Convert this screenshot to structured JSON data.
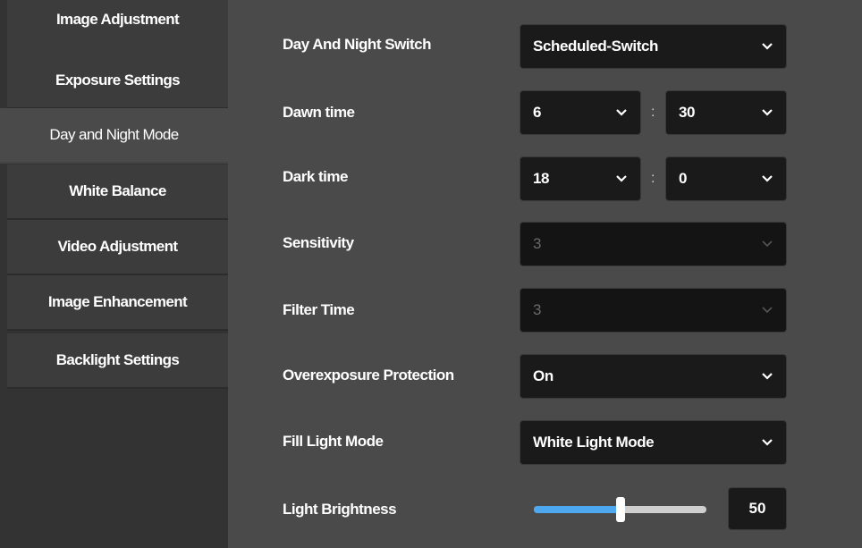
{
  "sidebar": {
    "items": [
      {
        "label": "Image Adjustment"
      },
      {
        "label": "Exposure Settings"
      },
      {
        "label": "Day and Night Mode"
      },
      {
        "label": "White Balance"
      },
      {
        "label": "Video Adjustment"
      },
      {
        "label": "Image Enhancement"
      },
      {
        "label": "Backlight Settings"
      }
    ],
    "active_index": 2
  },
  "form": {
    "day_night_switch": {
      "label": "Day And Night Switch",
      "value": "Scheduled-Switch"
    },
    "dawn_time": {
      "label": "Dawn time",
      "hour": "6",
      "minute": "30",
      "separator": ":"
    },
    "dark_time": {
      "label": "Dark time",
      "hour": "18",
      "minute": "0",
      "separator": ":"
    },
    "sensitivity": {
      "label": "Sensitivity",
      "value": "3",
      "disabled": true
    },
    "filter_time": {
      "label": "Filter Time",
      "value": "3",
      "disabled": true
    },
    "overexposure_protection": {
      "label": "Overexposure Protection",
      "value": "On"
    },
    "fill_light_mode": {
      "label": "Fill Light Mode",
      "value": "White Light Mode"
    },
    "light_brightness": {
      "label": "Light Brightness",
      "value": "50",
      "fraction": 0.5
    }
  },
  "icons": {
    "dropdown": "chevron-down-icon"
  },
  "colors": {
    "accent": "#4ea8f0",
    "background": "#4a4a4a",
    "sidebar": "#333333",
    "field": "#1a1a1a"
  }
}
